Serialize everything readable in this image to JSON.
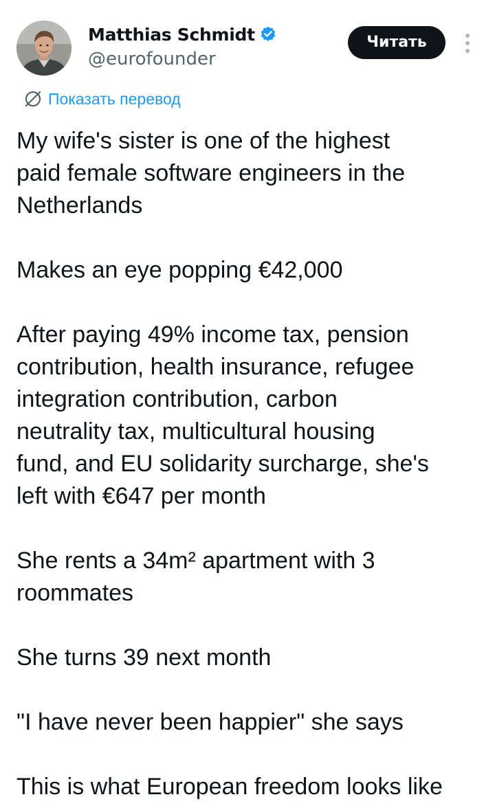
{
  "author": {
    "display_name": "Matthias Schmidt",
    "handle": "@eurofounder",
    "verified": true,
    "avatar_icon": "profile-photo"
  },
  "header": {
    "read_button_label": "Читать",
    "more_icon": "vertical-ellipsis-icon"
  },
  "translate": {
    "icon": "globe-icon",
    "label": "Показать перевод"
  },
  "colors": {
    "text": "#0f1419",
    "secondary_text": "#536471",
    "accent": "#1d9bf0",
    "button_bg": "#0f1419",
    "button_text": "#ffffff"
  },
  "tweet": {
    "paragraphs": [
      "My wife's sister is one of the highest\npaid female software engineers in the\nNetherlands",
      "Makes an eye popping €42,000",
      "After paying 49% income tax, pension\ncontribution, health insurance, refugee\nintegration contribution, carbon\nneutrality tax, multicultural housing\nfund, and EU solidarity surcharge, she's\nleft with €647 per month",
      "She rents a 34m² apartment with 3\nroommates",
      "She turns 39 next month",
      "\"I have never been happier\" she says",
      "This is what European freedom looks like"
    ]
  }
}
